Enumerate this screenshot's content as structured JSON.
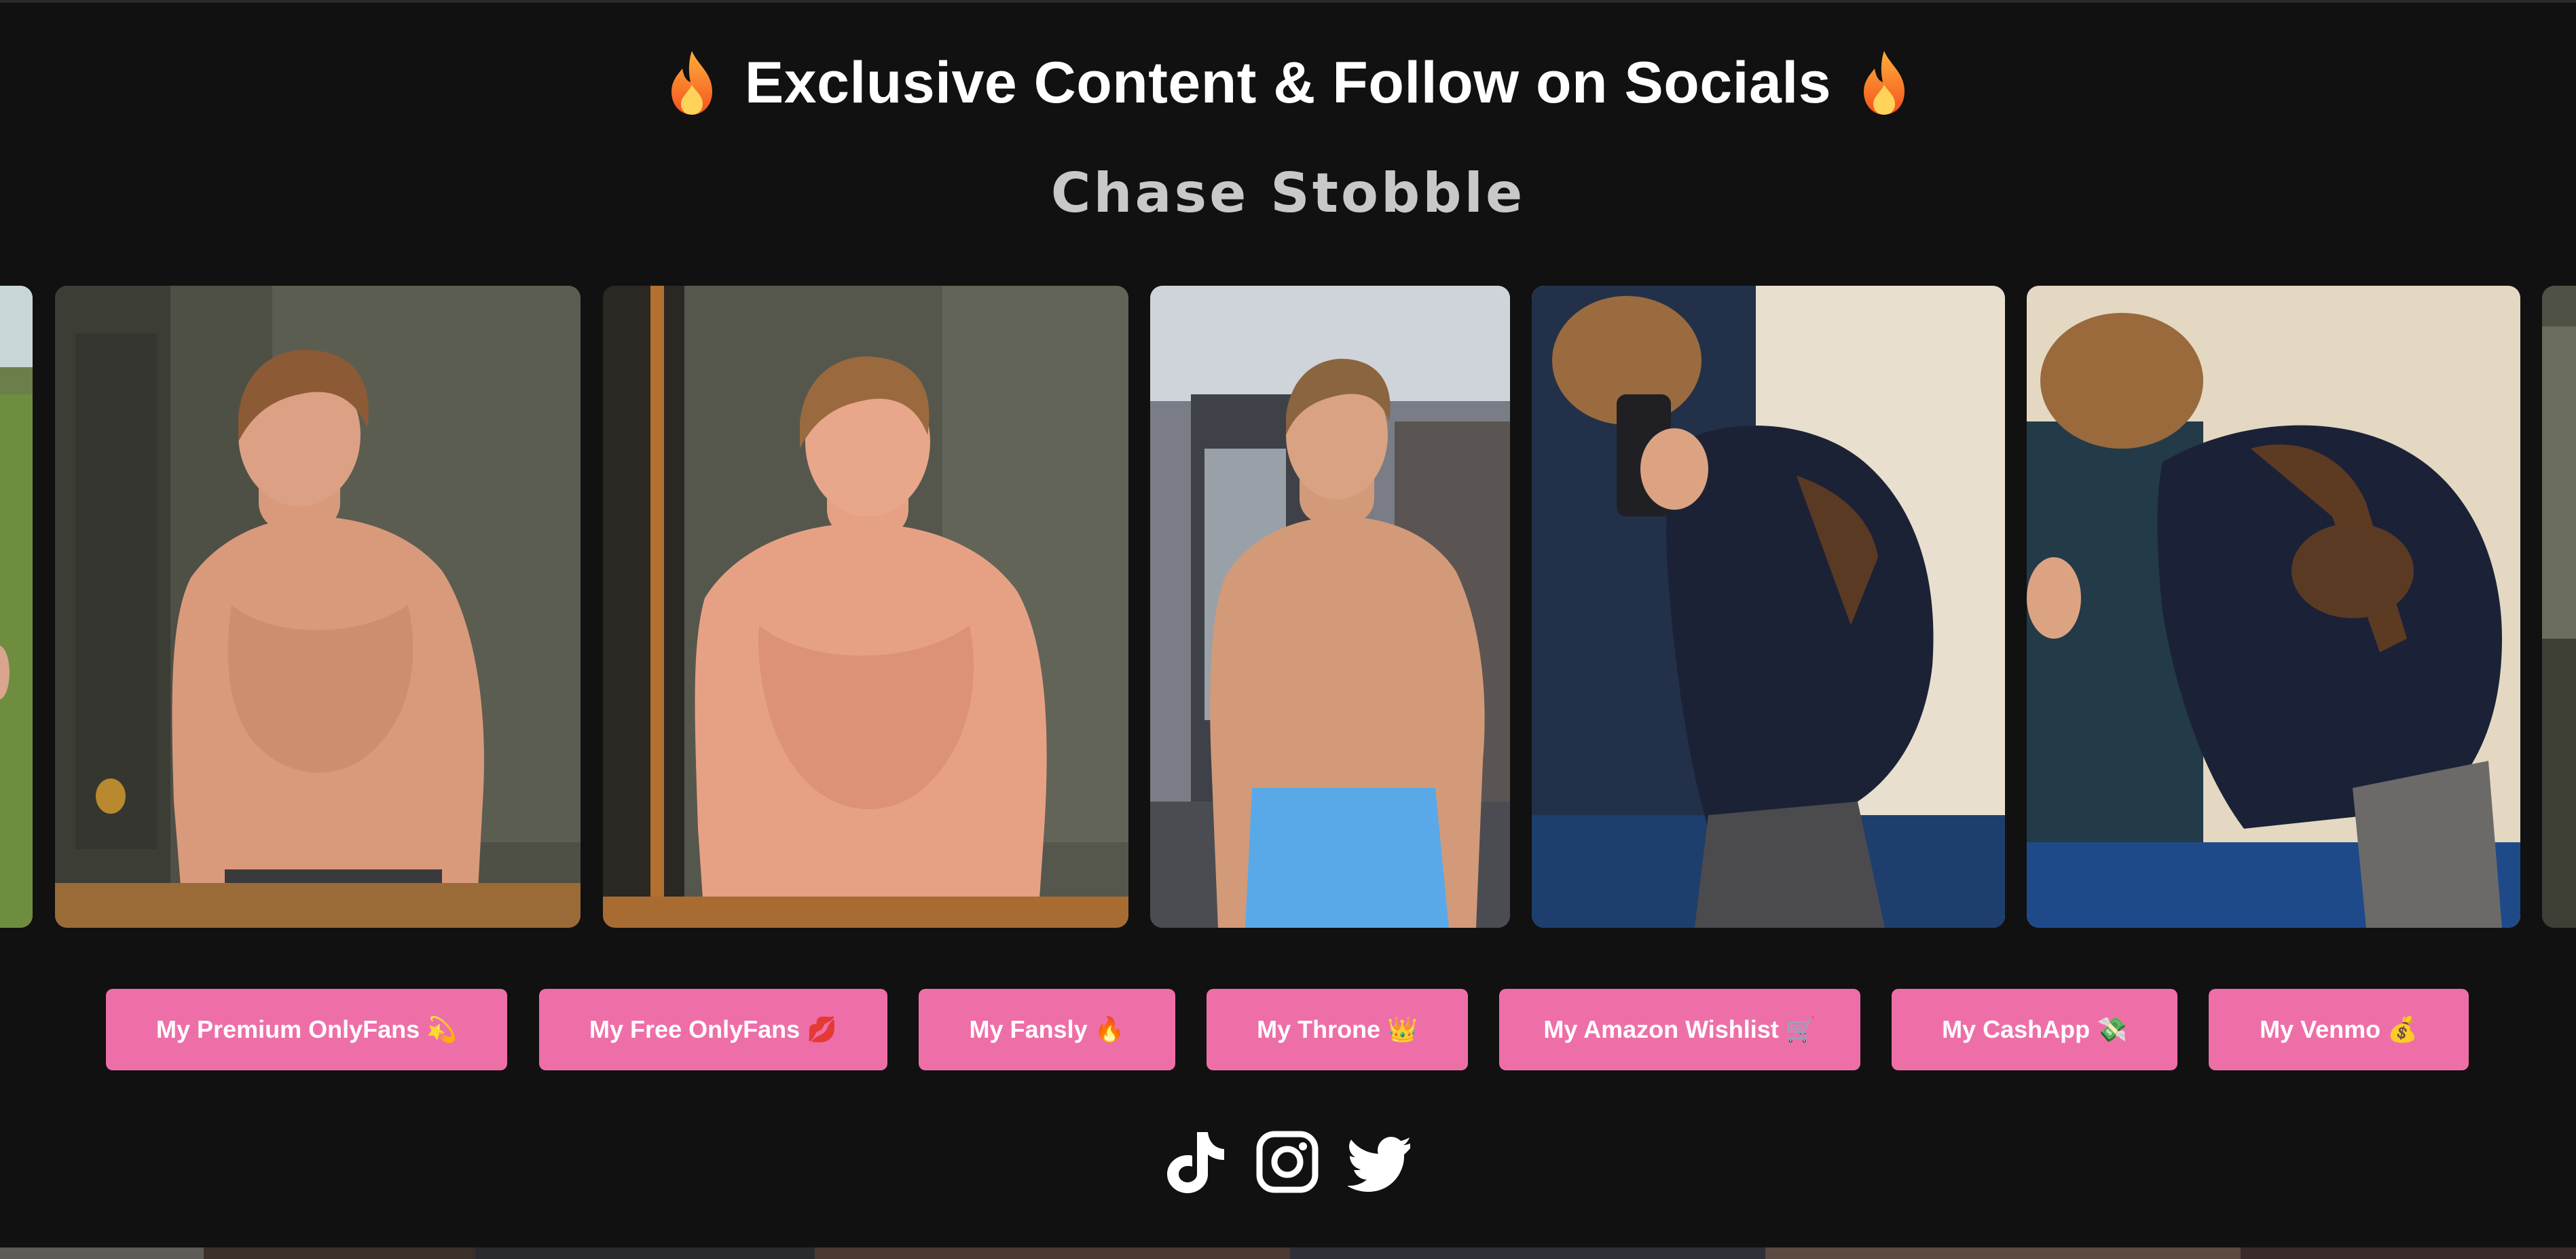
{
  "header": {
    "title": "Exclusive Content & Follow on Socials",
    "title_icon": "fire-emoji-icon",
    "subtitle": "Chase Stobble"
  },
  "gallery": {
    "photos": [
      {
        "name": "gallery-photo-partial-left"
      },
      {
        "name": "gallery-photo-1"
      },
      {
        "name": "gallery-photo-2"
      },
      {
        "name": "gallery-photo-3"
      },
      {
        "name": "gallery-photo-4"
      },
      {
        "name": "gallery-photo-5"
      },
      {
        "name": "gallery-photo-partial-right"
      }
    ]
  },
  "links": [
    {
      "label": "My Premium OnlyFans 💫"
    },
    {
      "label": "My Free OnlyFans 💋"
    },
    {
      "label": "My Fansly 🔥"
    },
    {
      "label": "My Throne 👑"
    },
    {
      "label": "My Amazon Wishlist 🛒"
    },
    {
      "label": "My CashApp 💸"
    },
    {
      "label": "My Venmo 💰"
    }
  ],
  "socials": [
    {
      "icon": "tiktok-icon"
    },
    {
      "icon": "instagram-icon"
    },
    {
      "icon": "twitter-icon"
    }
  ],
  "colors": {
    "background": "#111111",
    "button": "#ee6fa8",
    "title": "#ffffff",
    "subtitle": "#c8c8c8"
  }
}
